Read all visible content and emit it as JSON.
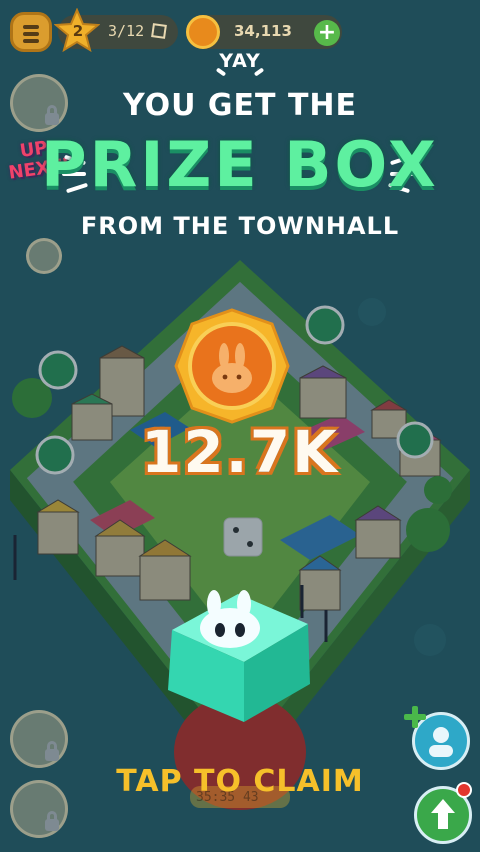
{
  "hud": {
    "level": "2",
    "quests": "3/12",
    "coins": "34,113",
    "plus": "+"
  },
  "side": {
    "up_next": "UP NEXT!"
  },
  "reward": {
    "yay": "YAY",
    "line1": "YOU GET THE",
    "title": "PRIZE BOX",
    "line2": "FROM THE TOWNHALL",
    "amount": "12.7K",
    "cta": "TAP TO CLAIM"
  },
  "bottom": {
    "timer": "35:35 43"
  },
  "colors": {
    "prize_green": "#5ef0a0",
    "cta_yellow": "#f6c02a",
    "coin_orange": "#e88a1c",
    "box_teal": "#3ee3b8"
  },
  "icons": [
    "menu-icon",
    "star-icon",
    "cube-icon",
    "coin-icon",
    "plus-icon",
    "lock-icon",
    "gift-icon",
    "arrow-up-icon",
    "avatar-icon",
    "dice-icon"
  ]
}
